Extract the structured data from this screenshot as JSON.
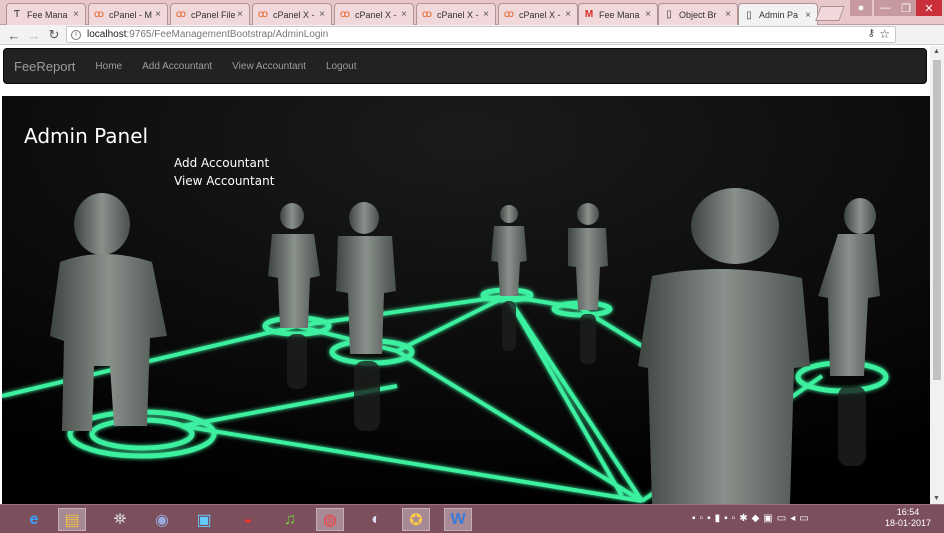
{
  "browser": {
    "tabs": [
      {
        "label": "Fee Mana",
        "icon": "text-icon"
      },
      {
        "label": "cPanel - M",
        "icon": "cpanel-icon"
      },
      {
        "label": "cPanel File",
        "icon": "cpanel-icon"
      },
      {
        "label": "cPanel X -",
        "icon": "cpanel-icon"
      },
      {
        "label": "cPanel X -",
        "icon": "cpanel-icon"
      },
      {
        "label": "cPanel X -",
        "icon": "cpanel-icon"
      },
      {
        "label": "cPanel X -",
        "icon": "cpanel-icon"
      },
      {
        "label": "Fee Mana",
        "icon": "gmail-icon"
      },
      {
        "label": "Object Br",
        "icon": "page-icon"
      },
      {
        "label": "Admin Pa",
        "icon": "page-icon",
        "active": true
      }
    ],
    "url_host": "localhost",
    "url_path": ":9765/FeeManagementBootstrap/AdminLogin"
  },
  "navbar": {
    "brand": "FeeReport",
    "links": [
      "Home",
      "Add Accountant",
      "View Accountant",
      "Logout"
    ]
  },
  "hero": {
    "title": "Admin Panel",
    "links": [
      "Add Accountant",
      "View Accountant"
    ]
  },
  "taskbar": {
    "apps": [
      "ie-icon",
      "explorer-icon",
      "satellite-icon",
      "media-icon",
      "film-icon",
      "mail-icon",
      "music-icon",
      "chrome-icon",
      "eclipse-icon",
      "game-icon",
      "word-icon"
    ],
    "clock_time": "16:54",
    "clock_date": "18-01-2017"
  },
  "colors": {
    "tabstrip": "#e8c7cb",
    "navbar": "#222222",
    "hero_background": "#020302",
    "network_glow": "#3cf0a0",
    "taskbar": "#7b4f5c"
  }
}
